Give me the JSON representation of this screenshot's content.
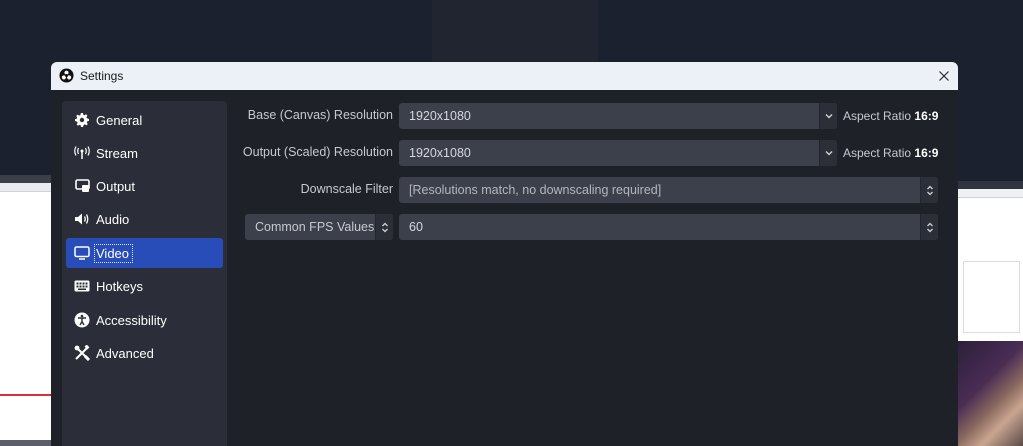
{
  "window": {
    "title": "Settings",
    "close_icon": "close-icon"
  },
  "sidebar": {
    "items": [
      {
        "label": "General",
        "icon": "gear-icon"
      },
      {
        "label": "Stream",
        "icon": "antenna-icon"
      },
      {
        "label": "Output",
        "icon": "output-icon"
      },
      {
        "label": "Audio",
        "icon": "speaker-icon"
      },
      {
        "label": "Video",
        "icon": "monitor-icon",
        "selected": true
      },
      {
        "label": "Hotkeys",
        "icon": "keyboard-icon"
      },
      {
        "label": "Accessibility",
        "icon": "accessibility-icon"
      },
      {
        "label": "Advanced",
        "icon": "tools-icon"
      }
    ]
  },
  "video": {
    "base_resolution": {
      "label": "Base (Canvas) Resolution",
      "value": "1920x1080",
      "aspect_prefix": "Aspect Ratio",
      "aspect_value": "16:9"
    },
    "output_resolution": {
      "label": "Output (Scaled) Resolution",
      "value": "1920x1080",
      "aspect_prefix": "Aspect Ratio",
      "aspect_value": "16:9"
    },
    "downscale_filter": {
      "label": "Downscale Filter",
      "value": "[Resolutions match, no downscaling required]"
    },
    "fps": {
      "type_value": "Common FPS Values",
      "value": "60"
    }
  },
  "colors": {
    "accent": "#284cb8",
    "panel": "#1f2129",
    "sidebar": "#2b2e38",
    "field": "#3c404b"
  }
}
